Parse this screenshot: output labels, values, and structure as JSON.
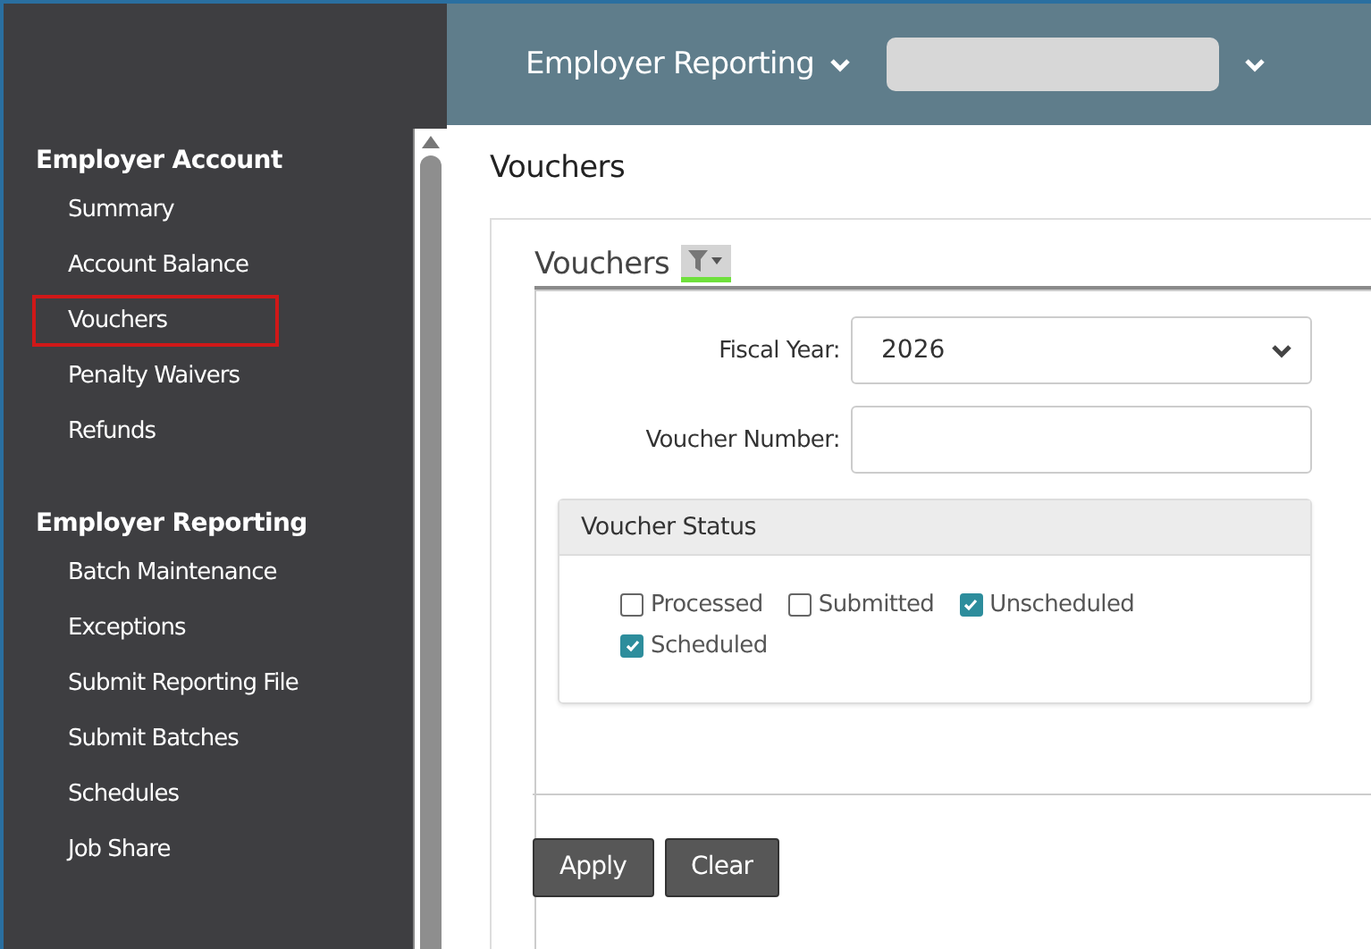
{
  "header": {
    "menu_label": "Employer Reporting"
  },
  "sidebar": {
    "sections": [
      {
        "title": "Employer Account",
        "items": [
          {
            "label": "Summary",
            "selected": false
          },
          {
            "label": "Account Balance",
            "selected": false
          },
          {
            "label": "Vouchers",
            "selected": true
          },
          {
            "label": "Penalty Waivers",
            "selected": false
          },
          {
            "label": "Refunds",
            "selected": false
          }
        ]
      },
      {
        "title": "Employer Reporting",
        "items": [
          {
            "label": "Batch Maintenance",
            "selected": false
          },
          {
            "label": "Exceptions",
            "selected": false
          },
          {
            "label": "Submit Reporting File",
            "selected": false
          },
          {
            "label": "Submit Batches",
            "selected": false
          },
          {
            "label": "Schedules",
            "selected": false
          },
          {
            "label": "Job Share",
            "selected": false
          }
        ]
      }
    ]
  },
  "page_title": "Vouchers",
  "card": {
    "title": "Vouchers",
    "fields": [
      {
        "kind": "select",
        "label": "Fiscal Year:",
        "value": "2026"
      },
      {
        "kind": "text",
        "label": "Voucher Number:"
      }
    ],
    "status_group": {
      "title": "Voucher Status",
      "options": [
        {
          "label": "Processed",
          "checked": false
        },
        {
          "label": "Submitted",
          "checked": false
        },
        {
          "label": "Unscheduled",
          "checked": true
        },
        {
          "label": "Scheduled",
          "checked": true
        }
      ]
    },
    "buttons": [
      "Apply",
      "Clear"
    ]
  }
}
